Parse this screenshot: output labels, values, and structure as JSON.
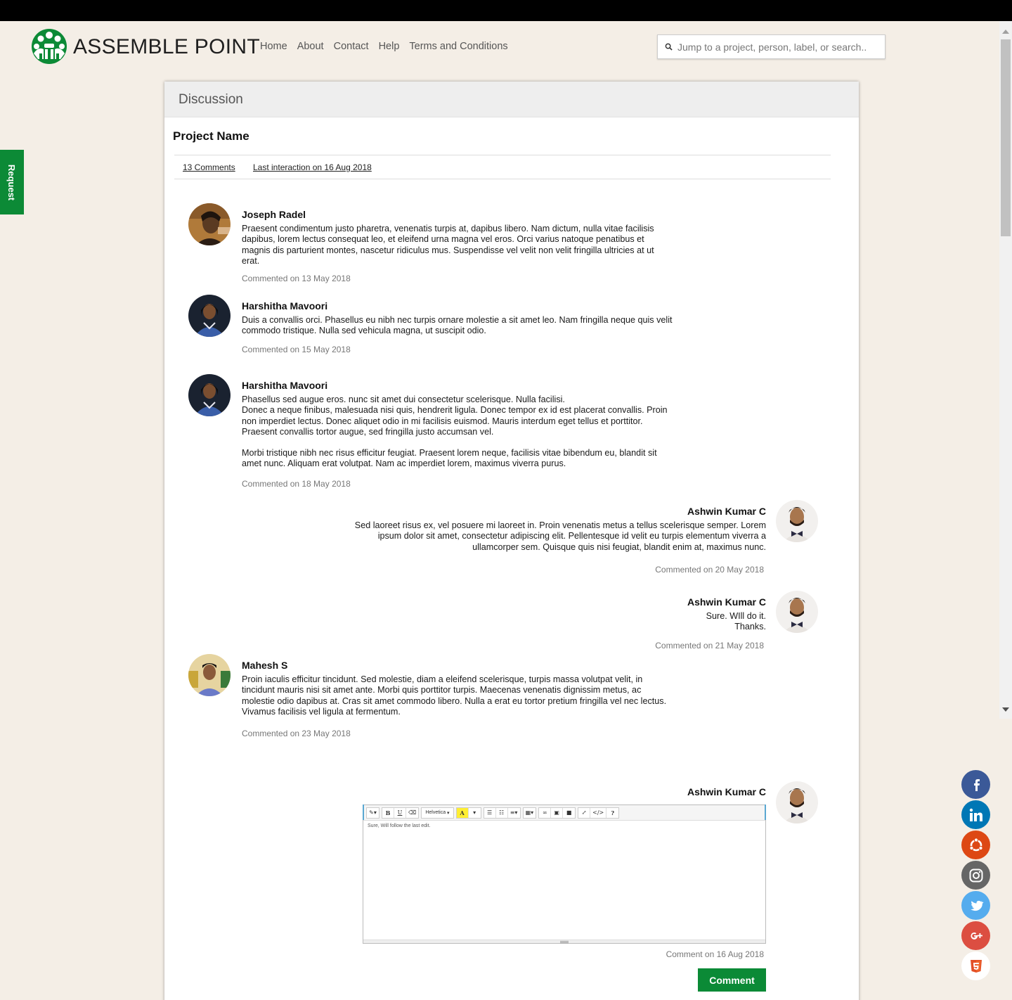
{
  "brand": {
    "name": "ASSEMBLE POINT",
    "color": "#0c8a36"
  },
  "nav": {
    "items": [
      "Home",
      "About",
      "Contact",
      "Help",
      "Terms and Conditions"
    ]
  },
  "search": {
    "placeholder": "Jump to a project, person, label, or search..."
  },
  "request_tab": {
    "label": "Request"
  },
  "discussion": {
    "header": "Discussion",
    "project_name": "Project Name",
    "comments_count": "13 Comments",
    "last_interaction": "Last interaction on 16 Aug 2018"
  },
  "comments": [
    {
      "author": "Joseph Radel",
      "text": "Praesent condimentum justo pharetra, venenatis turpis at, dapibus libero. Nam dictum, nulla vitae facilisis dapibus, lorem lectus consequat leo, et eleifend urna magna vel eros. Orci varius natoque penatibus et magnis dis parturient montes, nascetur ridiculus mus. Suspendisse vel velit non velit fringilla ultricies at ut erat.",
      "date": "Commented on 13 May 2018"
    },
    {
      "author": "Harshitha Mavoori",
      "text": "Duis a convallis orci. Phasellus eu nibh nec turpis ornare molestie a sit amet leo. Nam fringilla neque quis velit commodo tristique. Nulla sed vehicula magna, ut suscipit odio.",
      "date": "Commented on 15 May 2018"
    },
    {
      "author": "Harshitha Mavoori",
      "text_p1": "Phasellus sed augue eros.    nunc sit amet dui consectetur scelerisque. Nulla facilisi.\n Donec a neque finibus, malesuada nisi quis, hendrerit ligula.   Donec tempor ex id est placerat convallis. Proin non imperdiet lectus. Donec aliquet odio in mi facilisis euismod. Mauris interdum eget tellus et porttitor. Praesent convallis tortor augue, sed fringilla justo accumsan vel.",
      "text_p2": "Morbi tristique nibh nec risus efficitur feugiat. Praesent lorem neque, facilisis vitae bibendum eu, blandit sit amet nunc. Aliquam erat volutpat. Nam ac imperdiet lorem, maximus viverra purus.",
      "date": "Commented on 18 May 2018"
    },
    {
      "author": "Ashwin Kumar C",
      "text": "Sed laoreet risus ex, vel posuere mi laoreet in.   Proin venenatis metus a tellus scelerisque semper. Lorem ipsum dolor sit amet, consectetur adipiscing elit. Pellentesque id velit eu turpis elementum viverra a ullamcorper sem. Quisque quis nisi feugiat, blandit enim at, maximus nunc.",
      "date": "Commented on 20 May 2018"
    },
    {
      "author": "Ashwin Kumar C",
      "text": "Sure. WIll do it.\nThanks.",
      "date": "Commented on 21 May 2018"
    },
    {
      "author": "Mahesh S",
      "text": "Proin iaculis efficitur tincidunt. Sed molestie, diam a eleifend scelerisque, turpis massa volutpat velit, in tincidunt mauris nisi sit amet ante. Morbi quis porttitor turpis. Maecenas venenatis dignissim metus, ac molestie odio dapibus at. Cras sit amet commodo libero. Nulla a erat eu tortor pretium fringilla vel nec lectus. Vivamus facilisis vel ligula at fermentum.",
      "date": "Commented on 23 May 2018"
    }
  ],
  "reply": {
    "author": "Ashwin Kumar C",
    "editor_font": "Helvetica",
    "editor_text": "Sure, Will follow the last edit.",
    "date": "Comment on 16 Aug 2018",
    "button": "Comment"
  },
  "social": [
    {
      "icon": "facebook-icon",
      "color": "#3b5998"
    },
    {
      "icon": "linkedin-icon",
      "color": "#0077b5"
    },
    {
      "icon": "ubuntu-icon",
      "color": "#dd4814"
    },
    {
      "icon": "instagram-icon",
      "color": "#666666"
    },
    {
      "icon": "twitter-icon",
      "color": "#55acee"
    },
    {
      "icon": "google-plus-icon",
      "color": "#dc4e41"
    },
    {
      "icon": "html5-icon",
      "color": "#e34f26"
    }
  ]
}
